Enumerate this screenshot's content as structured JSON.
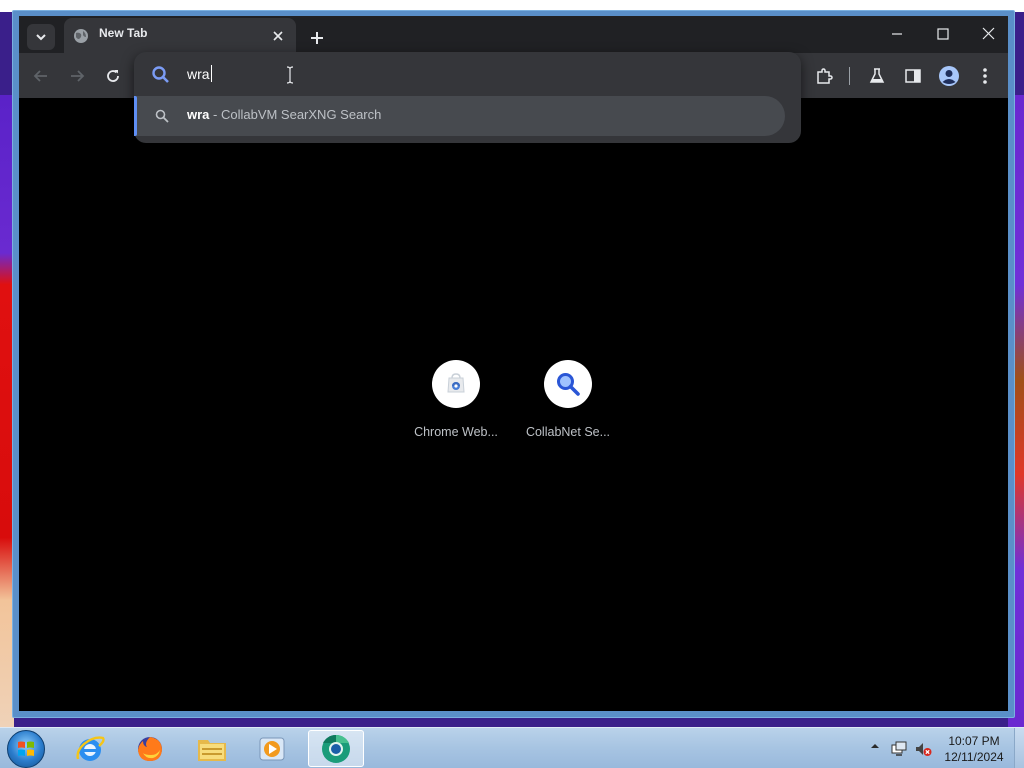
{
  "browser": {
    "tab": {
      "title": "New Tab"
    },
    "omnibox": {
      "input_value": "wra",
      "suggestion": {
        "query": "wra",
        "provider": " - CollabVM SearXNG Search"
      }
    },
    "shortcuts": [
      {
        "label": "Chrome Web...",
        "icon": "chrome-web-store-icon"
      },
      {
        "label": "CollabNet Se...",
        "icon": "search-magnifier-icon"
      }
    ],
    "toolbar_icons": [
      "back-icon",
      "forward-icon",
      "reload-icon",
      "extensions-icon",
      "labs-flask-icon",
      "side-panel-icon",
      "profile-icon",
      "more-menu-icon"
    ]
  },
  "taskbar": {
    "apps": [
      "internet-explorer-icon",
      "firefox-icon",
      "file-explorer-icon",
      "media-player-icon",
      "chrome-icon"
    ],
    "clock": {
      "time": "10:07 PM",
      "date": "12/11/2024"
    }
  },
  "colors": {
    "accent": "#5f8ff5",
    "toolbar": "#35363a",
    "titlebar": "#202124",
    "content_bg": "#000000"
  }
}
